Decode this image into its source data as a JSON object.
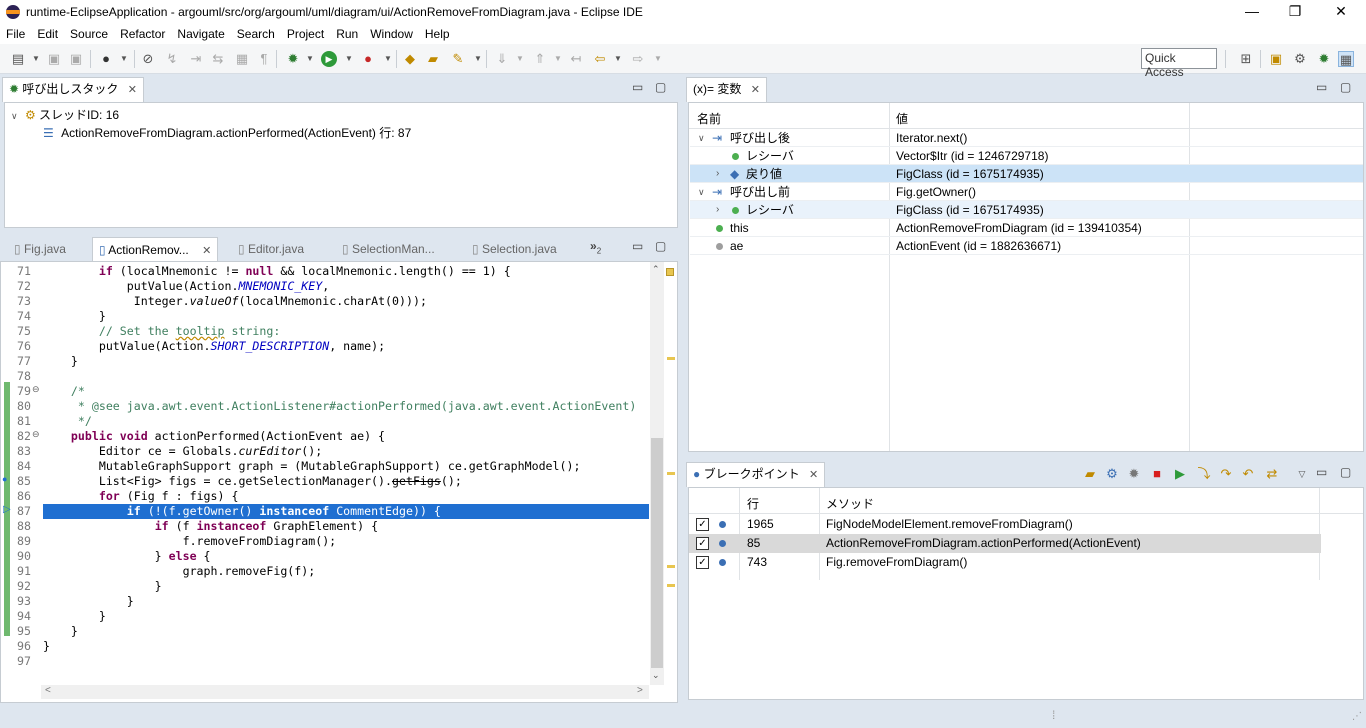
{
  "window": {
    "title": "runtime-EclipseApplication - argouml/src/org/argouml/uml/diagram/ui/ActionRemoveFromDiagram.java - Eclipse IDE",
    "minimize": "—",
    "restore": "❐",
    "close": "✕"
  },
  "menu": [
    "File",
    "Edit",
    "Source",
    "Refactor",
    "Navigate",
    "Search",
    "Project",
    "Run",
    "Window",
    "Help"
  ],
  "toolbar": {
    "quick_access": "Quick Access"
  },
  "callstack": {
    "tab_label": "呼び出しスタック",
    "thread": "スレッドID: 16",
    "frame": "ActionRemoveFromDiagram.actionPerformed(ActionEvent) 行: 87"
  },
  "editor": {
    "tabs": [
      "Fig.java",
      "ActionRemov...",
      "Editor.java",
      "SelectionMan...",
      "Selection.java"
    ],
    "overflow_count": "2",
    "line_numbers": [
      "71",
      "72",
      "73",
      "74",
      "75",
      "76",
      "77",
      "78",
      "79",
      "80",
      "81",
      "82",
      "83",
      "84",
      "85",
      "86",
      "87",
      "88",
      "89",
      "90",
      "91",
      "92",
      "93",
      "94",
      "95",
      "96",
      "97"
    ]
  },
  "variables": {
    "tab_label": "(x)= 変数",
    "col_name": "名前",
    "col_value": "値",
    "rows": [
      {
        "name": "呼び出し後",
        "value": "Iterator.next()"
      },
      {
        "name": "レシーバ",
        "value": "Vector$Itr (id = 1246729718)"
      },
      {
        "name": "戻り値",
        "value": "FigClass (id = 1675174935)"
      },
      {
        "name": "呼び出し前",
        "value": "Fig.getOwner()"
      },
      {
        "name": "レシーバ",
        "value": "FigClass (id = 1675174935)"
      },
      {
        "name": "this",
        "value": "ActionRemoveFromDiagram (id = 139410354)"
      },
      {
        "name": "ae",
        "value": "ActionEvent (id = 1882636671)"
      }
    ]
  },
  "breakpoints": {
    "tab_label": "ブレークポイント",
    "col_line": "行",
    "col_method": "メソッド",
    "rows": [
      {
        "line": "1965",
        "method": "FigNodeModelElement.removeFromDiagram()"
      },
      {
        "line": "85",
        "method": "ActionRemoveFromDiagram.actionPerformed(ActionEvent)"
      },
      {
        "line": "743",
        "method": "Fig.removeFromDiagram()"
      }
    ]
  },
  "colors": {
    "selection": "#1f6fd1",
    "keyword": "#7f0055",
    "comment": "#3f7f5f",
    "field": "#0000c0",
    "breakpoint_red": "#d81e1e"
  }
}
